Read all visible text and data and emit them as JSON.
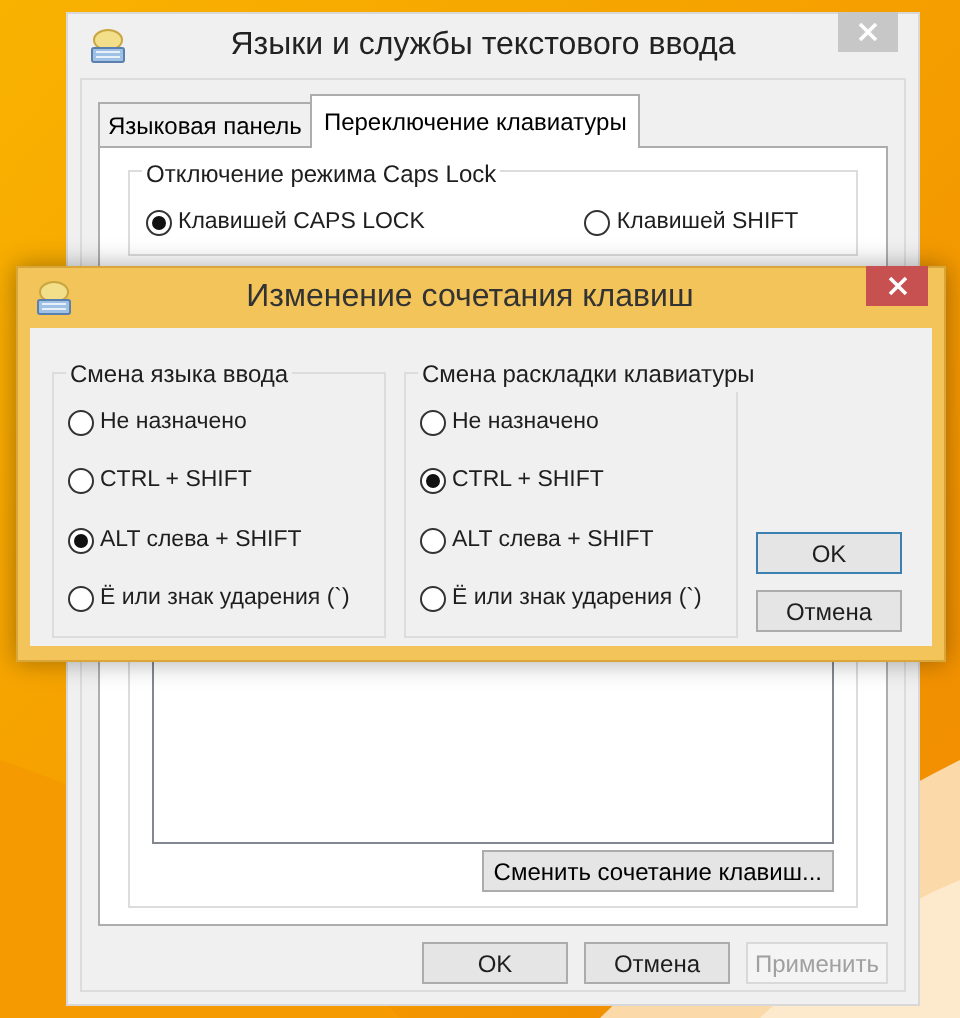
{
  "main_window": {
    "title": "Языки и службы текстового ввода",
    "tabs": [
      {
        "label": "Языковая панель",
        "selected": false
      },
      {
        "label": "Переключение клавиатуры",
        "selected": true
      }
    ],
    "caps_lock_group": {
      "title": "Отключение режима Caps Lock",
      "options": [
        {
          "label": "Клавишей CAPS LOCK",
          "selected": true
        },
        {
          "label": "Клавишей SHIFT",
          "selected": false
        }
      ]
    },
    "change_button": "Сменить сочетание клавиш...",
    "buttons": [
      {
        "label": "OK",
        "disabled": false
      },
      {
        "label": "Отмена",
        "disabled": false
      },
      {
        "label": "Применить",
        "disabled": true
      }
    ]
  },
  "dialog": {
    "title": "Изменение сочетания клавиш",
    "groups": [
      {
        "title": "Смена языка ввода",
        "options": [
          {
            "label": "Не назначено",
            "selected": false
          },
          {
            "label": "CTRL + SHIFT",
            "selected": false
          },
          {
            "label": "ALT слева + SHIFT",
            "selected": true
          },
          {
            "label": "Ё или знак ударения (`)",
            "selected": false
          }
        ]
      },
      {
        "title": "Смена раскладки клавиатуры",
        "options": [
          {
            "label": "Не назначено",
            "selected": false
          },
          {
            "label": "CTRL + SHIFT",
            "selected": true
          },
          {
            "label": "ALT слева + SHIFT",
            "selected": false
          },
          {
            "label": "Ё или знак ударения (`)",
            "selected": false
          }
        ]
      }
    ],
    "buttons": [
      {
        "label": "OK",
        "default": true
      },
      {
        "label": "Отмена",
        "default": false
      }
    ]
  }
}
